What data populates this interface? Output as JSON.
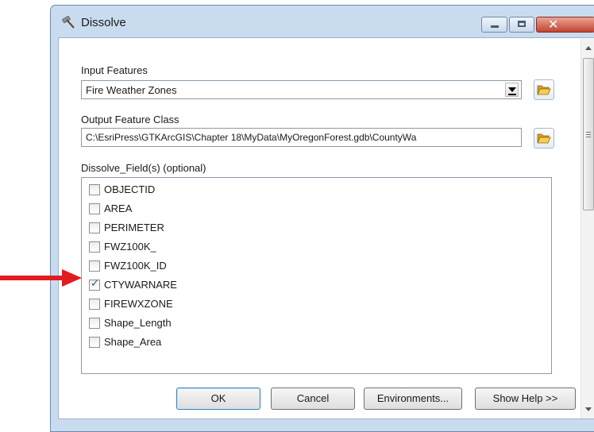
{
  "window": {
    "title": "Dissolve",
    "close_glyph": "✕"
  },
  "form": {
    "input_label": "Input Features",
    "input_value": "Fire Weather Zones",
    "output_label": "Output Feature Class",
    "output_value": "C:\\EsriPress\\GTKArcGIS\\Chapter 18\\MyData\\MyOregonForest.gdb\\CountyWa",
    "fields_label": "Dissolve_Field(s) (optional)",
    "fields": [
      {
        "label": "OBJECTID",
        "checked": false
      },
      {
        "label": "AREA",
        "checked": false
      },
      {
        "label": "PERIMETER",
        "checked": false
      },
      {
        "label": "FWZ100K_",
        "checked": false
      },
      {
        "label": "FWZ100K_ID",
        "checked": false
      },
      {
        "label": "CTYWARNARE",
        "checked": true
      },
      {
        "label": "FIREWXZONE",
        "checked": false
      },
      {
        "label": "Shape_Length",
        "checked": false
      },
      {
        "label": "Shape_Area",
        "checked": false
      }
    ],
    "check_glyph": "✓"
  },
  "buttons": {
    "ok": "OK",
    "cancel": "Cancel",
    "environments": "Environments...",
    "show_help": "Show Help >>"
  },
  "icons": {
    "title": "hammer-tool-icon",
    "browse": "folder-open-icon",
    "dropdown": "dropdown-arrow-icon",
    "annotation": "red-arrow-annotation"
  },
  "colors": {
    "window_frame": "#c9dcef",
    "close_button": "#c34430",
    "folder": "#e9b93c",
    "annotation_arrow": "#e11b22",
    "checkmark": "#2c4f86"
  }
}
